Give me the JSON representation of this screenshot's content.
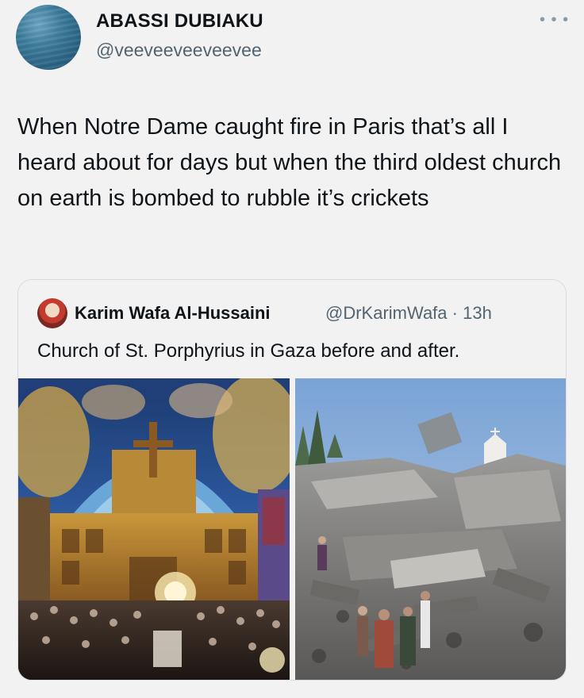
{
  "tweet": {
    "author_name": "ABASSI DUBIAKU",
    "author_handle": "@veeveeveeveevee",
    "more_icon": "ellipsis-icon",
    "text": "When Notre Dame caught fire in Paris that’s all I heard about for days but when the third oldest church on earth is bombed to rubble it’s crickets"
  },
  "quoted_tweet": {
    "author_name": "Karim Wafa Al-Hussaini",
    "author_handle": "@DrKarimWafa",
    "separator": "·",
    "time": "13h",
    "text": "Church of St. Porphyrius in Gaza before and after."
  },
  "colors": {
    "background": "#f2f2f2",
    "text_primary": "#0f1419",
    "text_secondary": "#536471",
    "border": "#d7dbdf"
  }
}
